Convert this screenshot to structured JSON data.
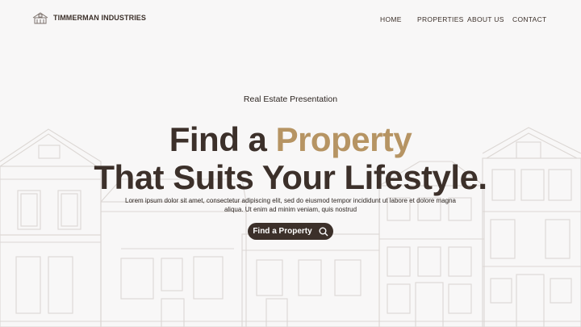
{
  "brand": {
    "name": "TIMMERMAN INDUSTRIES",
    "logo_icon": "house-logo-icon"
  },
  "nav": {
    "items": [
      "HOME",
      "PROPERTIES",
      "ABOUT US",
      "CONTACT"
    ]
  },
  "hero": {
    "subtitle": "Real Estate Presentation",
    "headline_line1_prefix": "Find a ",
    "headline_line1_accent": "Property",
    "headline_line2": "That Suits Your Lifestyle.",
    "body": "Lorem ipsum dolor sit amet, consectetur adipiscing elit, sed do eiusmod tempor incididunt ut labore et dolore magna aliqua. Ut enim ad minim veniam, quis nostrud",
    "cta_label": "Find a Property",
    "cta_icon": "search-icon"
  },
  "colors": {
    "background": "#f8f7f7",
    "primary": "#3c302a",
    "accent": "#b69463",
    "line_art": "#d9d4d1"
  }
}
